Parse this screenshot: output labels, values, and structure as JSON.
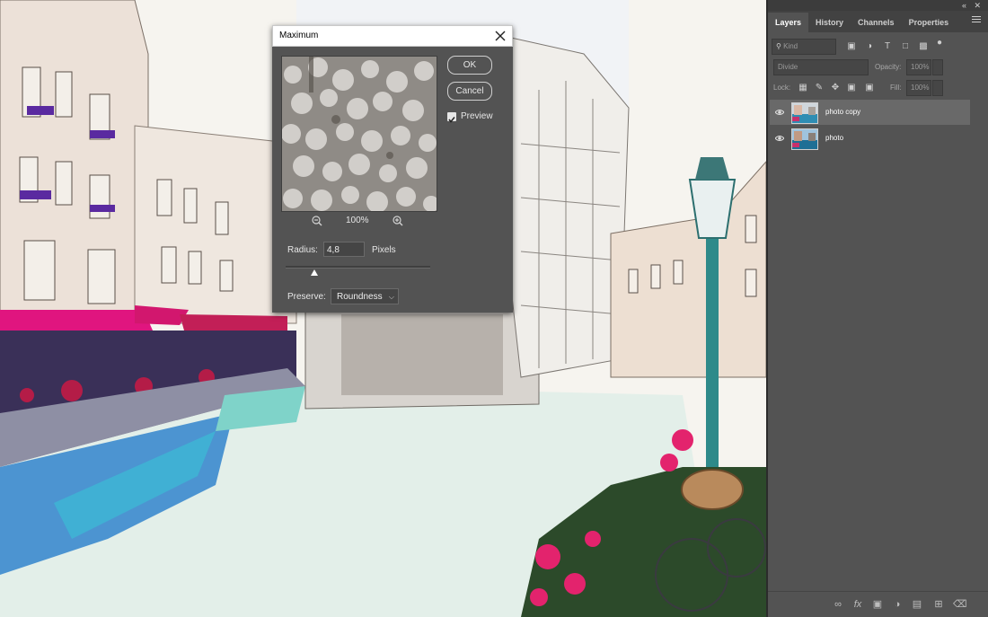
{
  "panel": {
    "tabs": [
      {
        "label": "Layers",
        "active": true
      },
      {
        "label": "History",
        "active": false
      },
      {
        "label": "Channels",
        "active": false
      },
      {
        "label": "Properties",
        "active": false
      }
    ],
    "filter_kind": "Kind",
    "blend_mode": "Divide",
    "opacity_label": "Opacity:",
    "opacity_value": "100%",
    "lock_label": "Lock:",
    "fill_label": "Fill:",
    "fill_value": "100%",
    "layers": [
      {
        "name": "photo copy",
        "selected": true,
        "visible": true
      },
      {
        "name": "photo",
        "selected": false,
        "visible": true
      }
    ],
    "bottom_icons": [
      "link-icon",
      "fx-icon",
      "mask-icon",
      "adjustment-icon",
      "folder-icon",
      "new-layer-icon",
      "trash-icon"
    ],
    "fx_label": "fx"
  },
  "dialog": {
    "title": "Maximum",
    "ok_label": "OK",
    "cancel_label": "Cancel",
    "preview_label": "Preview",
    "preview_checked": true,
    "zoom_value": "100%",
    "radius_label": "Radius:",
    "radius_value": "4,8",
    "radius_unit": "Pixels",
    "preserve_label": "Preserve:",
    "preserve_value": "Roundness"
  },
  "colors": {
    "panel_bg": "#535353",
    "selected_layer": "#696969",
    "awning_pink": "#e0157f",
    "water_cyan": "#39c3d6"
  }
}
